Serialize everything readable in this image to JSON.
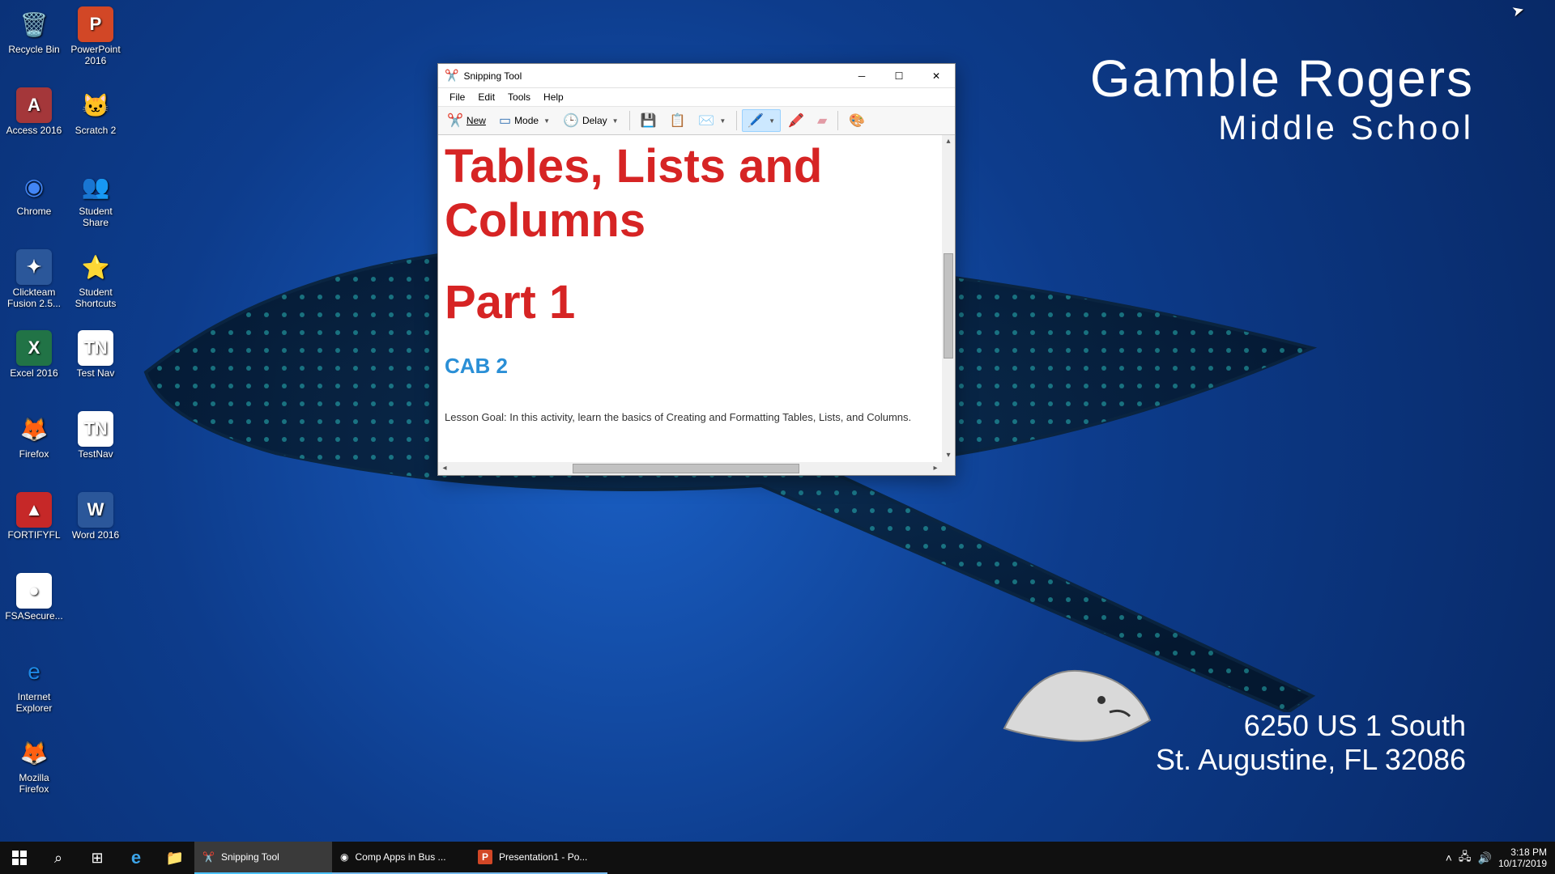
{
  "wallpaper": {
    "title_line1": "Gamble Rogers",
    "title_line2": "Middle School",
    "address_line1": "6250 US 1 South",
    "address_line2": "St. Augustine, FL 32086"
  },
  "desktop_icons": {
    "col1": [
      {
        "label": "Recycle Bin",
        "glyph": "🗑️"
      },
      {
        "label": "Access 2016",
        "glyph": "A",
        "bg": "#a4373a"
      },
      {
        "label": "Chrome",
        "glyph": "◉",
        "color": "#4285f4"
      },
      {
        "label": "Clickteam Fusion 2.5...",
        "glyph": "✦",
        "bg": "#2b579a"
      },
      {
        "label": "Excel 2016",
        "glyph": "X",
        "bg": "#217346"
      },
      {
        "label": "Firefox",
        "glyph": "🦊"
      },
      {
        "label": "FORTIFYFL",
        "glyph": "▲",
        "bg": "#c62828"
      },
      {
        "label": "FSASecure...",
        "glyph": "●",
        "bg": "#fff"
      },
      {
        "label": "Internet Explorer",
        "glyph": "e",
        "color": "#1e88e5"
      },
      {
        "label": "Mozilla Firefox",
        "glyph": "🦊"
      }
    ],
    "col2": [
      {
        "label": "PowerPoint 2016",
        "glyph": "P",
        "bg": "#d24726"
      },
      {
        "label": "Scratch 2",
        "glyph": "🐱"
      },
      {
        "label": "Student Share",
        "glyph": "👥"
      },
      {
        "label": "Student Shortcuts",
        "glyph": "⭐"
      },
      {
        "label": "Test Nav",
        "glyph": "TN",
        "bg": "#fff"
      },
      {
        "label": "TestNav",
        "glyph": "TN",
        "bg": "#fff"
      },
      {
        "label": "Word 2016",
        "glyph": "W",
        "bg": "#2b579a"
      }
    ]
  },
  "window": {
    "title": "Snipping Tool",
    "menus": {
      "file": "File",
      "edit": "Edit",
      "tools": "Tools",
      "help": "Help"
    },
    "toolbar": {
      "new": "New",
      "mode": "Mode",
      "delay": "Delay"
    },
    "snip": {
      "heading": "Tables, Lists and Columns",
      "part": "Part 1",
      "subtitle": "CAB 2",
      "body": "Lesson Goal:  In this activity, learn the basics of Creating and Formatting Tables, Lists, and Columns."
    }
  },
  "taskbar": {
    "items": [
      {
        "label": "Snipping Tool",
        "icon": "✂️",
        "state": "active"
      },
      {
        "label": "Comp Apps in Bus ...",
        "icon": "◉",
        "state": "open"
      },
      {
        "label": "Presentation1 - Po...",
        "icon": "P",
        "bg": "#d24726",
        "state": "open"
      }
    ],
    "time": "3:18 PM",
    "date": "10/17/2019"
  }
}
